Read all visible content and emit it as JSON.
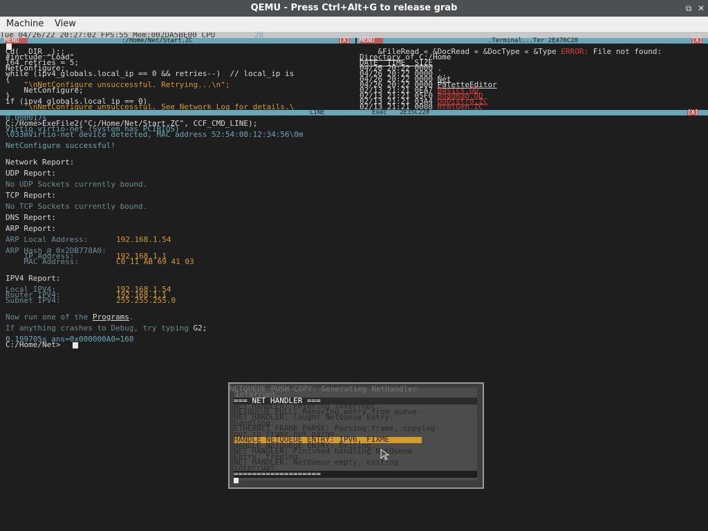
{
  "window": {
    "title": "QEMU - Press Ctrl+Alt+G to release grab",
    "restore_glyph": "⧉",
    "close_glyph": "✕"
  },
  "menu": {
    "items": [
      "Machine",
      "View"
    ]
  },
  "status": {
    "text": "Tue 04/26/22 20:27:02 FPS:55 Mem:002DA5BE00 CPU",
    "cpu_value": "28"
  },
  "editor_pane": {
    "tab_menu": "MENU",
    "tab_path": ":/Home/Net/Start.ZC",
    "tab_close": "[X]",
    "lines": [
      "Cd(__DIR__);;",
      "#include \"Load\"",
      "I64 retries = 5;",
      "NetConfigure;",
      "while (ipv4_globals.local_ip == 0 && retries--)  // local_ip is",
      "{",
      "    \"\\nNetConfigure unsuccessful. Retrying...\\n\";",
      "    NetConfigure;",
      "}",
      "if (ipv4_globals.local_ip == 0)",
      "    \"\\nNetConfigure unsuccessful. See Network Log for details.\\"
    ]
  },
  "dir_pane": {
    "tab_menu": "MENU",
    "tab_title": ".Terminal...Ter 2E470C28",
    "tab_close": "[X]",
    "error_line_prefix": "&FileRead « &DocRead « &DocType « &Type ",
    "error_word": "ERROR:",
    "error_rest": " File not found:",
    "heading_dir": "Directory",
    "heading_of": " of C:/Home",
    "columns": "DATE_ TIME_ SIZE",
    "rows": [
      {
        "meta": "04/26 20:22 0000 ",
        "name": ".",
        "cls": "white"
      },
      {
        "meta": "04/26 20:22 0000 ",
        "name": "..",
        "cls": "white"
      },
      {
        "meta": "04/26 20:22 0000 ",
        "name": "Net",
        "cls": "white"
      },
      {
        "meta": "04/26 20:22 0000 ",
        "name": "PaletteEditor",
        "cls": "white"
      },
      {
        "meta": "02/13 21:21 0EA7 ",
        "name": "Basics.DD",
        "cls": "red"
      },
      {
        "meta": "02/13 21:21 05F0 ",
        "name": "Roadmap.DD",
        "cls": "red"
      },
      {
        "meta": "02/13 21:21 03A4 ",
        "name": "DoDistro.ZC",
        "cls": "red"
      },
      {
        "meta": "02/13 21:21 0008 ",
        "name": "HtmlGen.ZC",
        "cls": "red"
      }
    ]
  },
  "bottom_tabs": {
    "line_label": "LINE",
    "exec_label": "Exec",
    "exec_id": "2E35C228",
    "tab_close": "[X]"
  },
  "terminal": {
    "lines": [
      {
        "t": "0.000017s",
        "c": "cyan"
      },
      {
        "t": "C:/Home>ExeFile2(\"C:/Home/Net/Start.ZC\", CCF_CMD_LINE);",
        "c": "white"
      },
      {
        "t": "Virtio virtio-net (System has PCIBIOS)",
        "c": "cyan"
      },
      {
        "t": "\\033mVirtio-net device detected, MAC address 52:54:00:12:34:56\\0m",
        "c": "cyan"
      },
      {
        "t": "NetConfigure successful!",
        "c": "cyan"
      },
      {
        "t": "Network Report:",
        "c": "white"
      },
      {
        "t": "UDP Report:",
        "c": "white"
      },
      {
        "t": "No UDP Sockets currently bound.",
        "c": "dim"
      },
      {
        "t": "TCP Report:",
        "c": "white"
      },
      {
        "t": "No TCP Sockets currently bound.",
        "c": "dim"
      },
      {
        "t": "DNS Report:",
        "c": "white"
      },
      {
        "t": "ARP Report:",
        "c": "white"
      }
    ],
    "arp_local_label": "ARP Local Address:",
    "arp_local_value": "192.168.1.54",
    "arp_hash_line": "ARP Hash @ 0x2DB778A0:",
    "arp_ip_label": "    IP Address:",
    "arp_ip_value": "192.168.1.1",
    "arp_mac_label": "    MAC Address:",
    "arp_mac_value": "C0 11 AB 69 41 03",
    "ipv4_title": "IPV4 Report:",
    "ipv4_local_label": "Local IPV4:",
    "ipv4_local_value": "192.168.1.54",
    "ipv4_router_label": "Router IPV4:",
    "ipv4_router_value": "192.168.1.1",
    "ipv4_subnet_label": "Subnet IPV4:",
    "ipv4_subnet_value": "255.255.255.0",
    "now_run_prefix": "Now run one of the ",
    "programs_link": "Programs",
    "now_run_suffix": ".",
    "crash_prefix": "If anything crashes to Debug, try typing ",
    "crash_cmd": "G2;",
    "timing_line": "0.199705s ans=0x000000A0=160",
    "prompt": "C:/Home/Net>"
  },
  "popup": {
    "top_line": "NETQUEUE PUSH COPY: Generating NetHandler",
    "top_line2": "interrupt.",
    "header": "=== NET HANDLER ===",
    "lines": [
      "NET HANDLER: Entering interrupt.",
      "NETQUEUE PULL: Removing entry from queue.",
      "NET HANDLER: Caught NetQueue Entry,",
      "handling.",
      "ETHERNET FRAME PARSE: Parsing frame, copying",
      "out to frame out param."
    ],
    "highlight": "HANDLE NETQUEUE ENTRY: IPV6, FIXME",
    "lines_after": [
      "HANDLE NETQUEUE ENTRY: Exiting.",
      "NET HANDLER: Finished handling NetQueue",
      "Entry, freeing.",
      "NET HANDLER: NetQueue empty, exiting",
      "interrupt."
    ],
    "footer": "==================="
  },
  "colors": {
    "highlight_bg": "#d49a2a",
    "accent": "#6aa7b8",
    "tag_bg": "#c25a5a"
  }
}
